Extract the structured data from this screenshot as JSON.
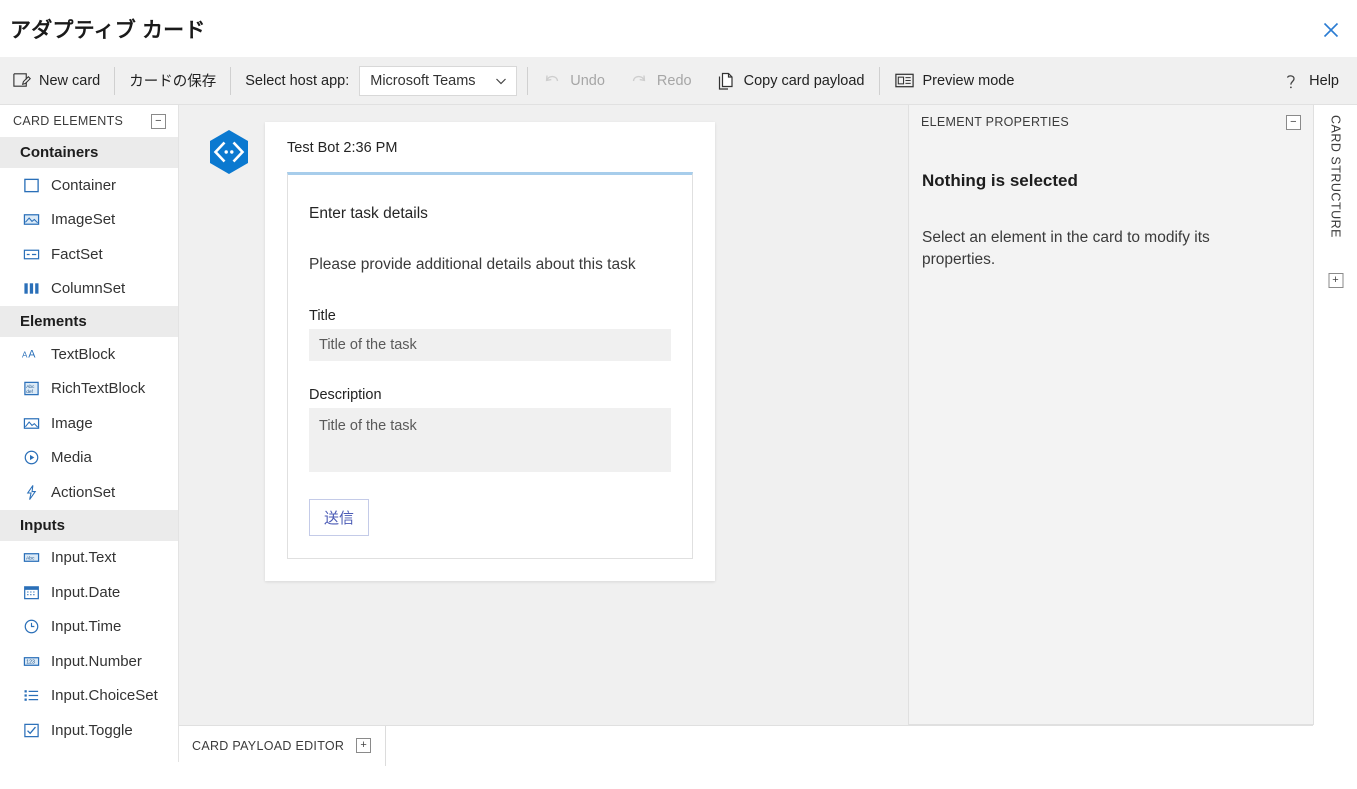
{
  "window": {
    "title": "アダプティブ カード",
    "close_label": "×",
    "close_color": "#2b7cd3"
  },
  "toolbar": {
    "new_card": "New card",
    "save_card": "カードの保存",
    "select_host_app_label": "Select host app:",
    "host_app_value": "Microsoft Teams",
    "host_app_options": [
      "Microsoft Teams"
    ],
    "undo": "Undo",
    "redo": "Redo",
    "copy_card_payload": "Copy card payload",
    "preview_mode": "Preview mode",
    "help": "Help"
  },
  "sidebar": {
    "header": "CARD ELEMENTS",
    "collapse_glyph": "−",
    "sections": [
      {
        "title": "Containers",
        "items": [
          {
            "label": "Container",
            "icon": "container-icon"
          },
          {
            "label": "ImageSet",
            "icon": "imageset-icon"
          },
          {
            "label": "FactSet",
            "icon": "factset-icon"
          },
          {
            "label": "ColumnSet",
            "icon": "columnset-icon"
          }
        ]
      },
      {
        "title": "Elements",
        "items": [
          {
            "label": "TextBlock",
            "icon": "textblock-icon"
          },
          {
            "label": "RichTextBlock",
            "icon": "richtextblock-icon"
          },
          {
            "label": "Image",
            "icon": "image-icon"
          },
          {
            "label": "Media",
            "icon": "media-icon"
          },
          {
            "label": "ActionSet",
            "icon": "actionset-icon"
          }
        ]
      },
      {
        "title": "Inputs",
        "items": [
          {
            "label": "Input.Text",
            "icon": "input-text-icon"
          },
          {
            "label": "Input.Date",
            "icon": "input-date-icon"
          },
          {
            "label": "Input.Time",
            "icon": "input-time-icon"
          },
          {
            "label": "Input.Number",
            "icon": "input-number-icon"
          },
          {
            "label": "Input.ChoiceSet",
            "icon": "input-choiceset-icon"
          },
          {
            "label": "Input.Toggle",
            "icon": "input-toggle-icon"
          }
        ]
      }
    ]
  },
  "canvas": {
    "bot_avatar_icon": "bot-hexagon-code-icon",
    "bot_line": "Test Bot 2:36 PM",
    "card": {
      "accent_color": "#a7cdeb",
      "title": "Enter task details",
      "subtitle": "Please provide additional details about this task",
      "fields": [
        {
          "label": "Title",
          "placeholder": "Title of the task",
          "value": "",
          "type": "text"
        },
        {
          "label": "Description",
          "placeholder": "Title of the task",
          "value": "",
          "type": "textarea"
        }
      ],
      "submit_label": "送信"
    }
  },
  "properties": {
    "header": "ELEMENT PROPERTIES",
    "collapse_glyph": "−",
    "title": "Nothing is selected",
    "description": "Select an element in the card to modify its properties."
  },
  "rail": {
    "label": "CARD STRUCTURE",
    "expand_glyph": "+"
  },
  "payload_editor": {
    "label": "CARD PAYLOAD EDITOR",
    "expand_glyph": "+"
  }
}
